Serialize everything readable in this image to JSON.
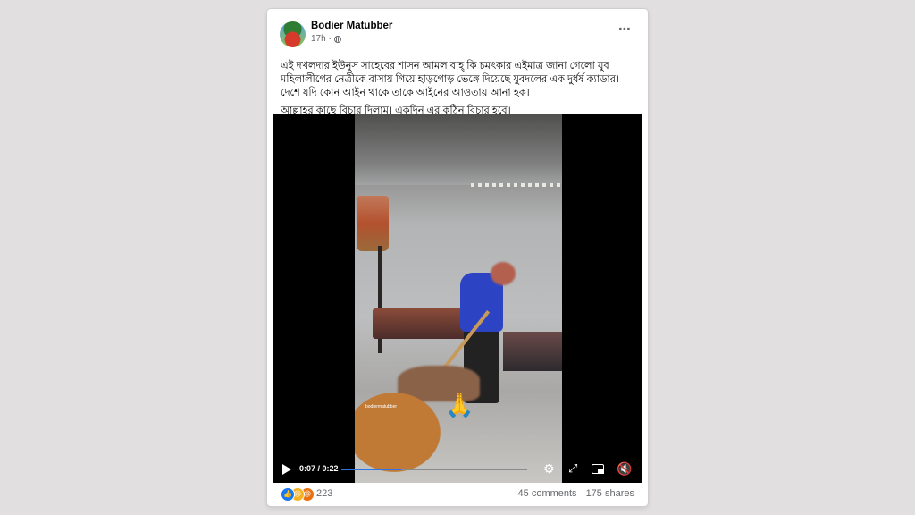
{
  "post": {
    "author": "Bodier Matubber",
    "time": "17h ·",
    "text_paragraph_1": "এই দখলদার ইউনুস সাহেবের শাসন আমল বাহ্ কি চমৎকার এইমাত্র জানা গেলো যুব মহিলালীগের নেত্রীকে বাসায় গিয়ে হাড়গোড় ভেঙ্গে দিয়েছে যুবদলের এক দুর্ধর্ষ ক্যাডার। দেশে যদি কোন আইন থাকে তাকে আইনের আওতায় আনা হক।",
    "text_paragraph_2": "আল্লাহর কাছে বিচার দিলাম। একদিন এর কঠিন বিচার হবে।",
    "more_icon": "⋯"
  },
  "video": {
    "time_display": "0:07 / 0:22",
    "progress": 0.32,
    "watermark": "bodiermatubber",
    "overlay_emoji": "🙏",
    "icons": {
      "play": "play-icon",
      "settings": "⚙",
      "fullscreen": "⤢",
      "pip": "pip-icon",
      "mute": "🔇"
    }
  },
  "footer": {
    "reaction_count": "223",
    "comments": "45 comments",
    "shares": "175 shares",
    "reaction_icons": [
      "👍",
      "😢",
      "😡"
    ]
  },
  "colors": {
    "accent": "#1877f2",
    "progress": "#2f75e6",
    "background": "#e1dfdf"
  }
}
